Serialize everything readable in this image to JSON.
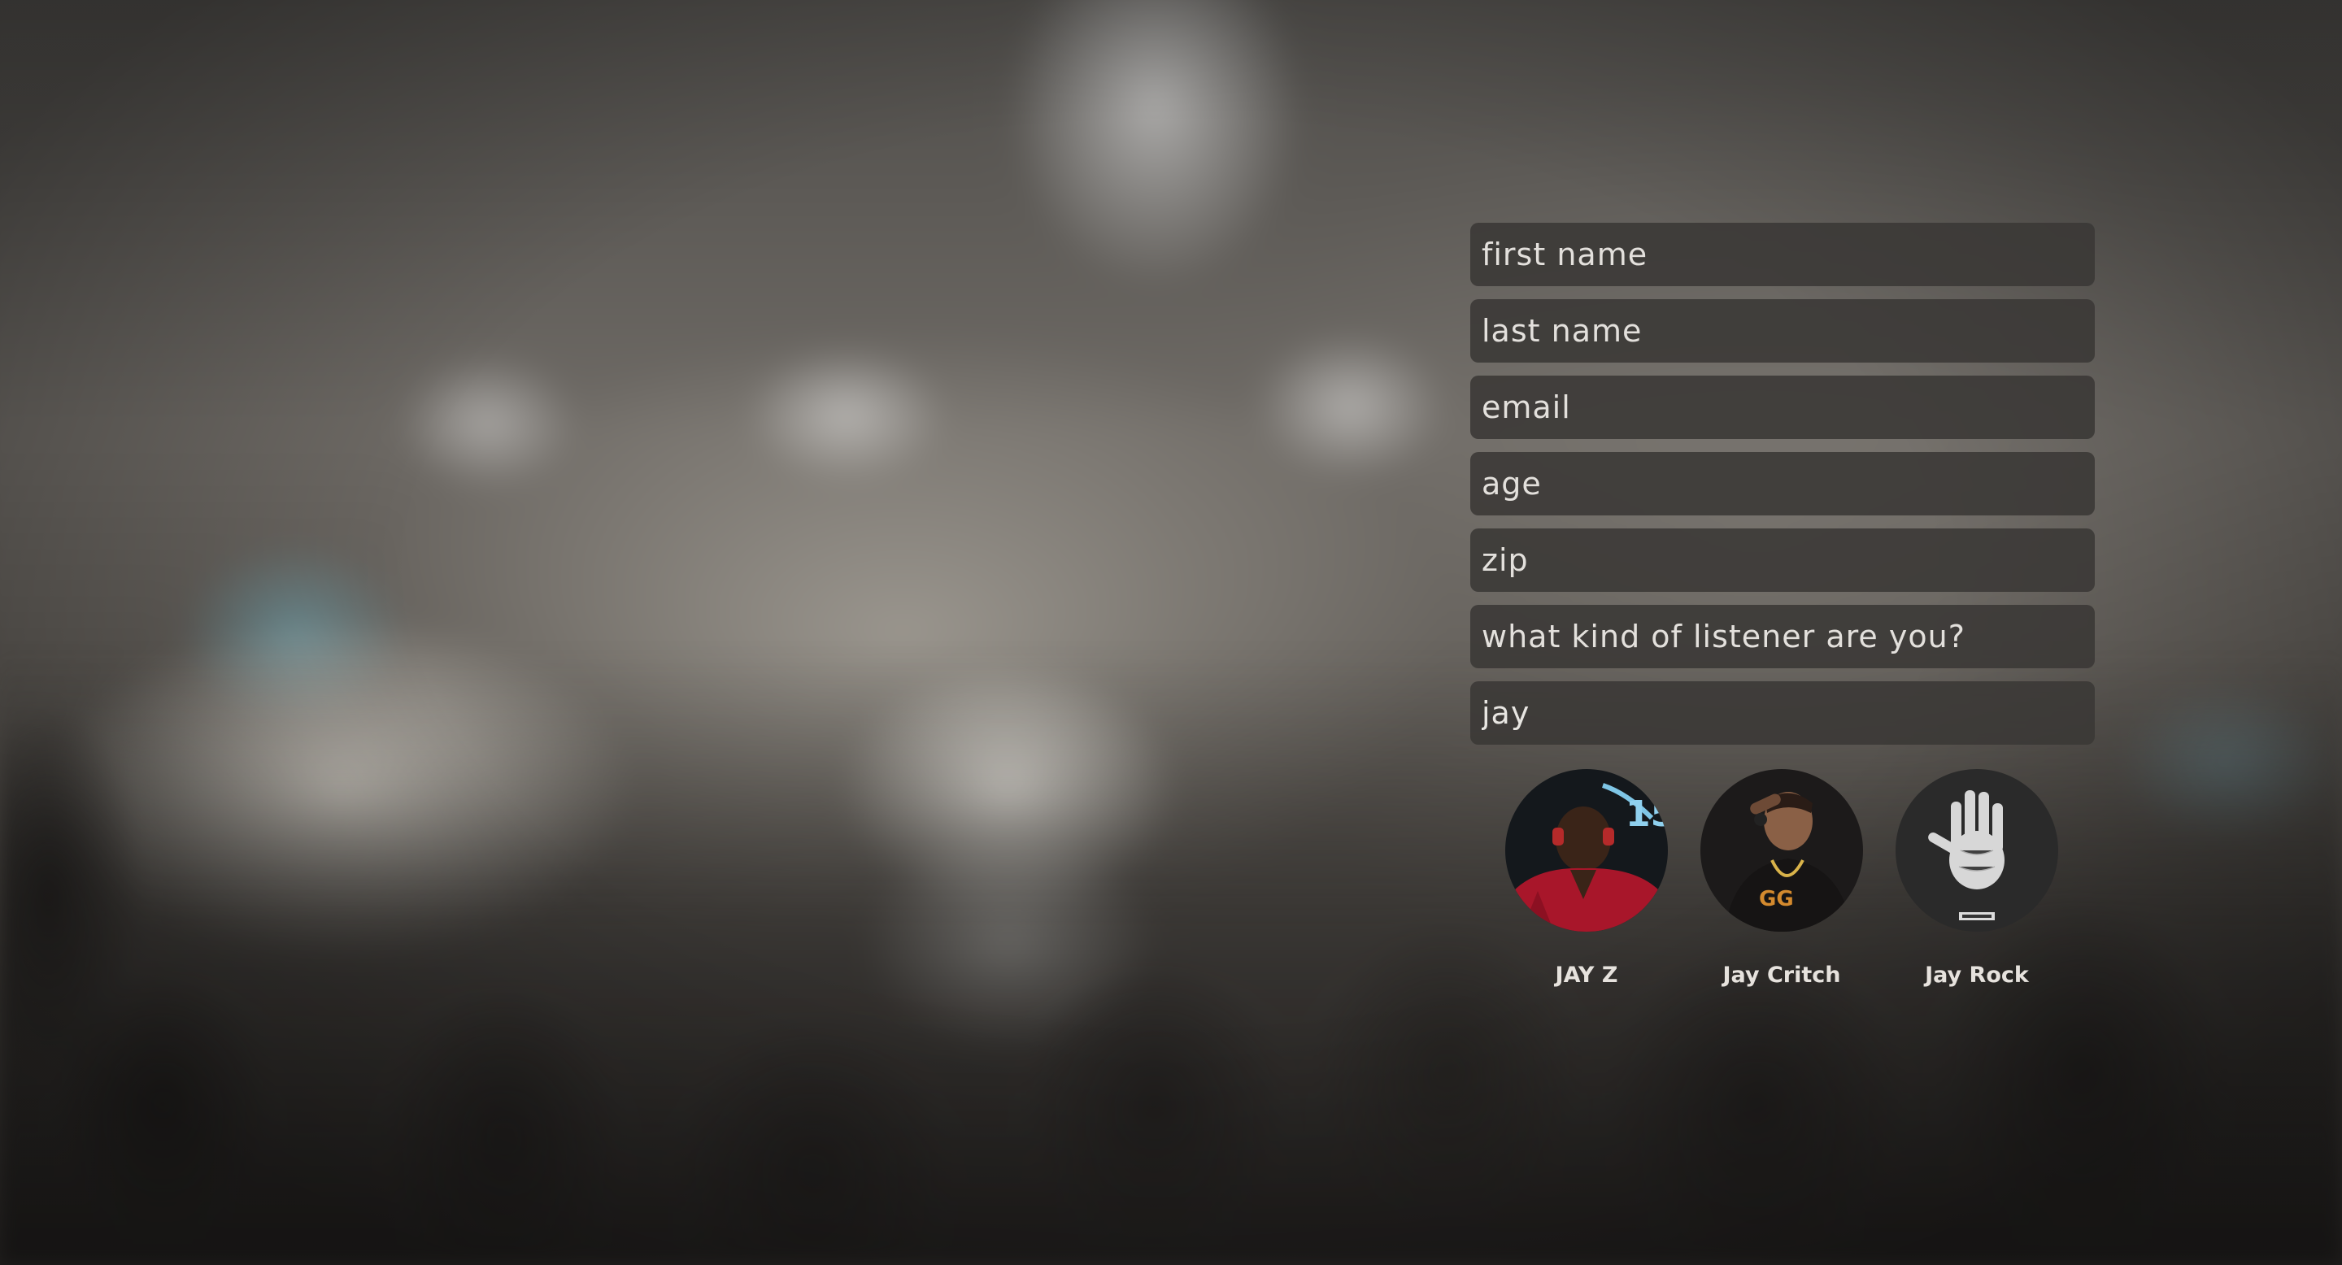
{
  "form": {
    "first_name_placeholder": "first name",
    "last_name_placeholder": "last name",
    "email_placeholder": "email",
    "age_placeholder": "age",
    "zip_placeholder": "zip",
    "listener_type_placeholder": "what kind of listener are you?",
    "artist_search_value": "jay"
  },
  "artist_results": [
    {
      "name": "JAY Z",
      "icon": "artist-photo-jay-z"
    },
    {
      "name": "Jay Critch",
      "icon": "artist-photo-jay-critch"
    },
    {
      "name": "Jay Rock",
      "icon": "artist-photo-jay-rock"
    }
  ],
  "colors": {
    "field_background": "#3a3836",
    "field_text": "#e8e6e2",
    "label_text": "#e6e2dd"
  }
}
